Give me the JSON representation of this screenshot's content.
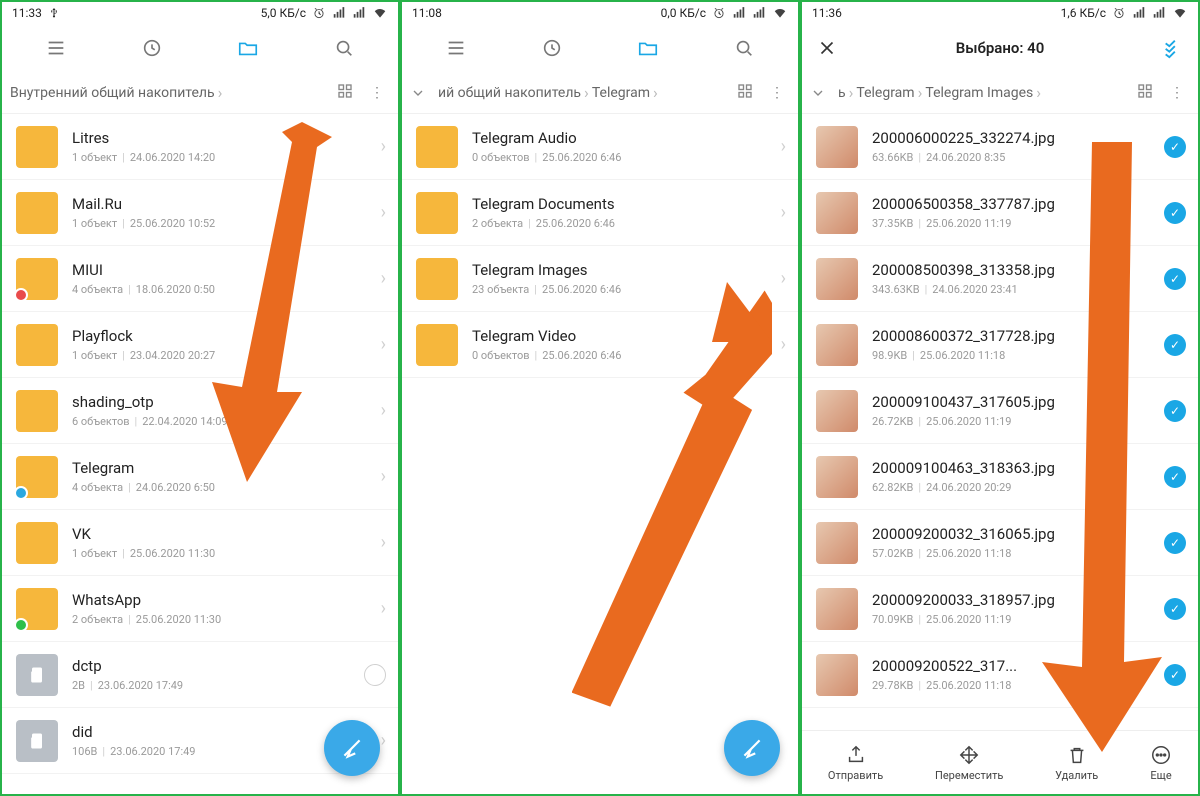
{
  "panes": [
    {
      "status": {
        "time": "11:33",
        "net": "5,0 КБ/с"
      },
      "crumb_single": "Внутренний общий накопитель",
      "rows": [
        {
          "name": "Litres",
          "sub1": "1 объект",
          "sub2": "24.06.2020 14:20",
          "type": "folder"
        },
        {
          "name": "Mail.Ru",
          "sub1": "1 объект",
          "sub2": "25.06.2020 10:52",
          "type": "folder"
        },
        {
          "name": "MIUI",
          "sub1": "4 объекта",
          "sub2": "18.06.2020 0:50",
          "type": "folder",
          "badge": "red"
        },
        {
          "name": "Playflock",
          "sub1": "1 объект",
          "sub2": "23.04.2020 20:27",
          "type": "folder"
        },
        {
          "name": "shading_otp",
          "sub1": "6 объектов",
          "sub2": "22.04.2020 14:09",
          "type": "folder"
        },
        {
          "name": "Telegram",
          "sub1": "4 объекта",
          "sub2": "24.06.2020 6:50",
          "type": "folder",
          "badge": "blue"
        },
        {
          "name": "VK",
          "sub1": "1 объект",
          "sub2": "25.06.2020 11:30",
          "type": "folder"
        },
        {
          "name": "WhatsApp",
          "sub1": "2 объекта",
          "sub2": "25.06.2020 11:30",
          "type": "folder",
          "badge": "green"
        },
        {
          "name": "dctp",
          "sub1": "2B",
          "sub2": "23.06.2020 17:49",
          "type": "file",
          "check": "empty"
        },
        {
          "name": "did",
          "sub1": "106B",
          "sub2": "23.06.2020 17:49",
          "type": "file"
        }
      ]
    },
    {
      "status": {
        "time": "11:08",
        "net": "0,0 КБ/с"
      },
      "crumb_parts": [
        "ий общий накопитель",
        "Telegram"
      ],
      "rows": [
        {
          "name": "Telegram Audio",
          "sub1": "0 объектов",
          "sub2": "25.06.2020 6:46",
          "type": "folder"
        },
        {
          "name": "Telegram Documents",
          "sub1": "2 объекта",
          "sub2": "25.06.2020 6:46",
          "type": "folder"
        },
        {
          "name": "Telegram Images",
          "sub1": "23 объекта",
          "sub2": "25.06.2020 6:46",
          "type": "folder"
        },
        {
          "name": "Telegram Video",
          "sub1": "0 объектов",
          "sub2": "25.06.2020 6:46",
          "type": "folder"
        }
      ]
    },
    {
      "status": {
        "time": "11:36",
        "net": "1,6 КБ/с"
      },
      "sel_title": "Выбрано: 40",
      "crumb_parts": [
        "ь",
        "Telegram",
        "Telegram Images"
      ],
      "rows": [
        {
          "name": "200006000225_332274.jpg",
          "sub1": "63.66KB",
          "sub2": "24.06.2020 8:35"
        },
        {
          "name": "200006500358_337787.jpg",
          "sub1": "37.35KB",
          "sub2": "25.06.2020 11:19"
        },
        {
          "name": "200008500398_313358.jpg",
          "sub1": "343.63KB",
          "sub2": "24.06.2020 23:41"
        },
        {
          "name": "200008600372_317728.jpg",
          "sub1": "98.9KB",
          "sub2": "25.06.2020 11:18"
        },
        {
          "name": "200009100437_317605.jpg",
          "sub1": "26.72KB",
          "sub2": "25.06.2020 11:19"
        },
        {
          "name": "200009100463_318363.jpg",
          "sub1": "62.82KB",
          "sub2": "24.06.2020 20:29"
        },
        {
          "name": "200009200032_316065.jpg",
          "sub1": "57.02KB",
          "sub2": "25.06.2020 11:18"
        },
        {
          "name": "200009200033_318957.jpg",
          "sub1": "70.09KB",
          "sub2": "25.06.2020 11:19"
        },
        {
          "name": "200009200522_317...",
          "sub1": "29.78KB",
          "sub2": "25.06.2020 11:18"
        }
      ],
      "actions": [
        {
          "label": "Отправить"
        },
        {
          "label": "Переместить"
        },
        {
          "label": "Удалить"
        },
        {
          "label": "Еще"
        }
      ]
    }
  ]
}
